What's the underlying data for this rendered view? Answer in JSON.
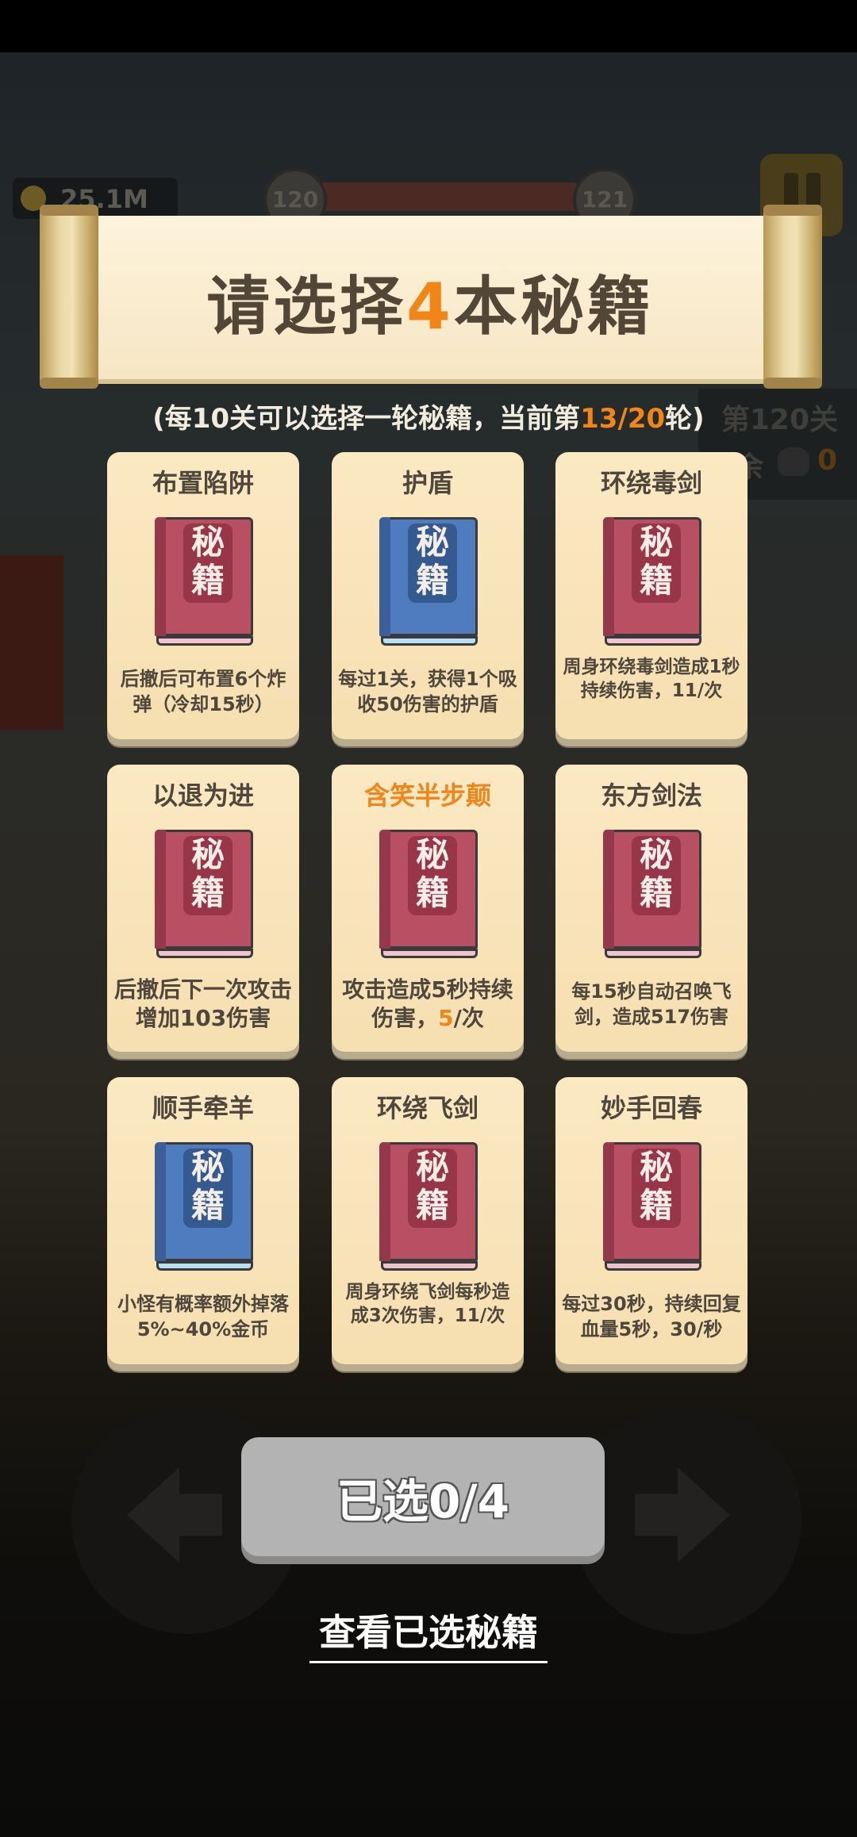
{
  "hud": {
    "coins": "25.1M",
    "level_current": "120",
    "level_next": "121",
    "stage": "第120关",
    "remaining_label": "剩余",
    "remaining_count": "0"
  },
  "header": {
    "title_prefix": "请选择",
    "title_count": "4",
    "title_suffix": "本秘籍",
    "subtitle_prefix": "(每10关可以选择一轮秘籍，当前第",
    "subtitle_round": "13/20",
    "subtitle_suffix": "轮)"
  },
  "book_chars": {
    "top": "秘",
    "bottom": "籍"
  },
  "cards": [
    {
      "title": "布置陷阱",
      "color": "red",
      "desc": "后撤后可布置6个炸弹（冷却15秒）"
    },
    {
      "title": "护盾",
      "color": "blue",
      "desc": "每过1关，获得1个吸收50伤害的护盾"
    },
    {
      "title": "环绕毒剑",
      "color": "red",
      "desc": "周身环绕毒剑造成1秒持续伤害，11/次"
    },
    {
      "title": "以退为进",
      "color": "red",
      "desc": "后撤后下一次攻击增加103伤害"
    },
    {
      "title": "含笑半步颠",
      "color": "red",
      "desc_prefix": "攻击造成5秒持续伤害，",
      "desc_value": "5",
      "desc_suffix": "/次"
    },
    {
      "title": "东方剑法",
      "color": "red",
      "desc": "每15秒自动召唤飞剑，造成517伤害"
    },
    {
      "title": "顺手牵羊",
      "color": "blue",
      "desc": "小怪有概率额外掉落5%~40%金币"
    },
    {
      "title": "环绕飞剑",
      "color": "red",
      "desc": "周身环绕飞剑每秒造成3次伤害，11/次"
    },
    {
      "title": "妙手回春",
      "color": "red",
      "desc": "每过30秒，持续回复血量5秒，30/秒"
    }
  ],
  "confirm_button": "已选0/4",
  "view_selected": "查看已选秘籍",
  "colors": {
    "highlight": "#f18617",
    "card_bg": "#fbe9c3",
    "book_red": "#b94f62",
    "book_blue": "#4f7cbf"
  }
}
